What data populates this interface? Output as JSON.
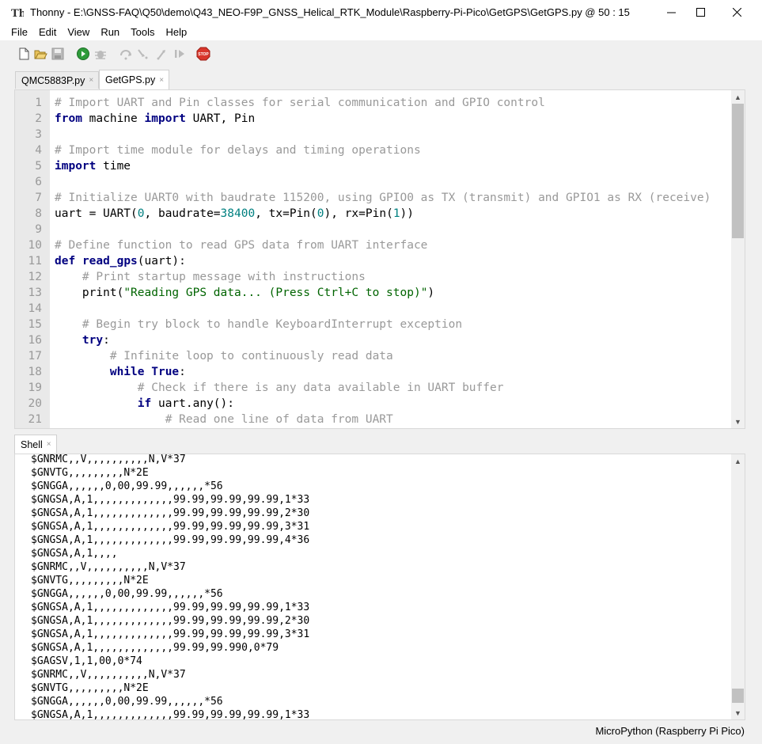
{
  "window": {
    "title": "Thonny  -  E:\\GNSS-FAQ\\Q50\\demo\\Q43_NEO-F9P_GNSS_Helical_RTK_Module\\Raspberry-Pi-Pico\\GetGPS\\GetGPS.py  @  50 : 15"
  },
  "menu": [
    "File",
    "Edit",
    "View",
    "Run",
    "Tools",
    "Help"
  ],
  "toolbar": {
    "icons": [
      "new-file-icon",
      "open-file-icon",
      "save-icon",
      "run-icon",
      "debug-icon",
      "step-over-icon",
      "step-into-icon",
      "step-out-icon",
      "resume-icon",
      "stop-icon"
    ],
    "stop_label": "STOP"
  },
  "editor_tabs": [
    {
      "label": "QMC5883P.py",
      "close": "×",
      "active": false
    },
    {
      "label": "GetGPS.py",
      "close": "×",
      "active": true
    }
  ],
  "editor": {
    "line_numbers": [
      "1",
      "2",
      "3",
      "4",
      "5",
      "6",
      "7",
      "8",
      "9",
      "10",
      "11",
      "12",
      "13",
      "14",
      "15",
      "16",
      "17",
      "18",
      "19",
      "20",
      "21"
    ],
    "lines": [
      [
        {
          "t": "# Import UART and Pin classes for serial communication and GPIO control",
          "c": "cm"
        }
      ],
      [
        {
          "t": "from",
          "c": "kw"
        },
        {
          "t": " machine ",
          "c": ""
        },
        {
          "t": "import",
          "c": "kw"
        },
        {
          "t": " UART, Pin",
          "c": ""
        }
      ],
      [],
      [
        {
          "t": "# Import time module for delays and timing operations",
          "c": "cm"
        }
      ],
      [
        {
          "t": "import",
          "c": "kw"
        },
        {
          "t": " time",
          "c": ""
        }
      ],
      [],
      [
        {
          "t": "# Initialize UART0 with baudrate 115200, using GPIO0 as TX (transmit) and GPIO1 as RX (receive)",
          "c": "cm"
        }
      ],
      [
        {
          "t": "uart = UART(",
          "c": ""
        },
        {
          "t": "0",
          "c": "num"
        },
        {
          "t": ", baudrate=",
          "c": ""
        },
        {
          "t": "38400",
          "c": "num"
        },
        {
          "t": ", tx=Pin(",
          "c": ""
        },
        {
          "t": "0",
          "c": "num"
        },
        {
          "t": "), rx=Pin(",
          "c": ""
        },
        {
          "t": "1",
          "c": "num"
        },
        {
          "t": "))",
          "c": ""
        }
      ],
      [],
      [
        {
          "t": "# Define function to read GPS data from UART interface",
          "c": "cm"
        }
      ],
      [
        {
          "t": "def",
          "c": "kw"
        },
        {
          "t": " ",
          "c": ""
        },
        {
          "t": "read_gps",
          "c": "fn"
        },
        {
          "t": "(uart):",
          "c": ""
        }
      ],
      [
        {
          "t": "    ",
          "c": ""
        },
        {
          "t": "# Print startup message with instructions",
          "c": "cm"
        }
      ],
      [
        {
          "t": "    print(",
          "c": ""
        },
        {
          "t": "\"Reading GPS data... (Press Ctrl+C to stop)\"",
          "c": "str"
        },
        {
          "t": ")",
          "c": ""
        }
      ],
      [],
      [
        {
          "t": "    ",
          "c": ""
        },
        {
          "t": "# Begin try block to handle KeyboardInterrupt exception",
          "c": "cm"
        }
      ],
      [
        {
          "t": "    ",
          "c": ""
        },
        {
          "t": "try",
          "c": "kw"
        },
        {
          "t": ":",
          "c": ""
        }
      ],
      [
        {
          "t": "        ",
          "c": ""
        },
        {
          "t": "# Infinite loop to continuously read data",
          "c": "cm"
        }
      ],
      [
        {
          "t": "        ",
          "c": ""
        },
        {
          "t": "while",
          "c": "kw"
        },
        {
          "t": " ",
          "c": ""
        },
        {
          "t": "True",
          "c": "kw"
        },
        {
          "t": ":",
          "c": ""
        }
      ],
      [
        {
          "t": "            ",
          "c": ""
        },
        {
          "t": "# Check if there is any data available in UART buffer",
          "c": "cm"
        }
      ],
      [
        {
          "t": "            ",
          "c": ""
        },
        {
          "t": "if",
          "c": "kw"
        },
        {
          "t": " uart.any():",
          "c": ""
        }
      ],
      [
        {
          "t": "                ",
          "c": ""
        },
        {
          "t": "# Read one line of data from UART",
          "c": "cm"
        }
      ]
    ]
  },
  "shell_tab": {
    "label": "Shell",
    "close": "×"
  },
  "shell": {
    "lines": [
      "$GNRMC,,V,,,,,,,,,,N,V*37",
      "$GNVTG,,,,,,,,,N*2E",
      "$GNGGA,,,,,,0,00,99.99,,,,,,*56",
      "$GNGSA,A,1,,,,,,,,,,,,,99.99,99.99,99.99,1*33",
      "$GNGSA,A,1,,,,,,,,,,,,,99.99,99.99,99.99,2*30",
      "$GNGSA,A,1,,,,,,,,,,,,,99.99,99.99,99.99,3*31",
      "$GNGSA,A,1,,,,,,,,,,,,,99.99,99.99,99.99,4*36",
      "$GNGSA,A,1,,,,",
      "$GNRMC,,V,,,,,,,,,,N,V*37",
      "$GNVTG,,,,,,,,,N*2E",
      "$GNGGA,,,,,,0,00,99.99,,,,,,*56",
      "$GNGSA,A,1,,,,,,,,,,,,,99.99,99.99,99.99,1*33",
      "$GNGSA,A,1,,,,,,,,,,,,,99.99,99.99,99.99,2*30",
      "$GNGSA,A,1,,,,,,,,,,,,,99.99,99.99,99.99,3*31",
      "$GNGSA,A,1,,,,,,,,,,,,,99.99,99.990,0*79",
      "$GAGSV,1,1,00,0*74",
      "$GNRMC,,V,,,,,,,,,,N,V*37",
      "$GNVTG,,,,,,,,,N*2E",
      "$GNGGA,,,,,,0,00,99.99,,,,,,*56",
      "$GNGSA,A,1,,,,,,,,,,,,,99.99,99.99,99.99,1*33"
    ]
  },
  "statusbar": {
    "interpreter": "MicroPython (Raspberry Pi Pico)"
  },
  "colors": {
    "comment": "#999999",
    "keyword": "#000080",
    "number": "#008080",
    "string": "#006400",
    "gutter": "#e9e9e9"
  }
}
